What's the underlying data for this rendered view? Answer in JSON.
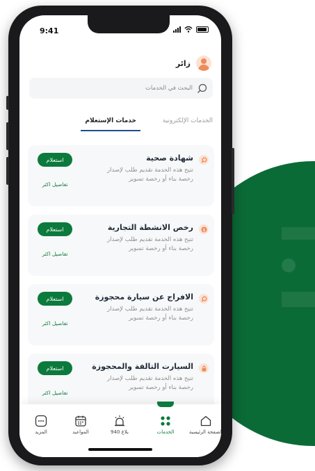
{
  "status_bar": {
    "time": "9:41"
  },
  "user": {
    "name": "زائر"
  },
  "search": {
    "placeholder": "البحث في الخدمات"
  },
  "tabs": [
    {
      "label": "الخدمات الإلكترونية",
      "active": false
    },
    {
      "label": "خدمات الإستعلام",
      "active": true
    }
  ],
  "cards": [
    {
      "title": "شهادة صحية",
      "desc": "تتيح هذه الخدمة تقديم طلب لإصدار رخصة بناء أو رخصة تسوير",
      "action": "استعلام",
      "more": "تفاصيل اكثر",
      "icon": "search-icon"
    },
    {
      "title": "رخص الانشطة التجارية",
      "desc": "تتيح هذه الخدمة تقديم طلب لإصدار رخصة بناء أو رخصة تسوير",
      "action": "استعلام",
      "more": "تفاصيل اكثر",
      "icon": "dollar-icon"
    },
    {
      "title": "الافراج عن سيارة محجوزة",
      "desc": "تتيح هذه الخدمة تقديم طلب لإصدار رخصة بناء أو رخصة تسوير",
      "action": "استعلام",
      "more": "تفاصيل اكثر",
      "icon": "search-icon"
    },
    {
      "title": "السيارت التالفة والمحجوزة",
      "desc": "تتيح هذه الخدمة تقديم طلب لإصدار رخصة بناء أو رخصة تسوير",
      "action": "استعلام",
      "more": "تفاصيل اكثر",
      "icon": "lock-icon"
    }
  ],
  "tabbar": [
    {
      "label": "المزيد",
      "icon": "more-icon"
    },
    {
      "label": "المواعيد",
      "icon": "calendar-icon"
    },
    {
      "label": "بلاغ 940",
      "icon": "alarm-icon"
    },
    {
      "label": "الخدمات",
      "icon": "grid-icon",
      "active": true
    },
    {
      "label": "الصفحة الرئيسية",
      "icon": "home-icon"
    }
  ],
  "colors": {
    "accent": "#0b7a3c",
    "brand_dark": "#0b6b36",
    "icon_orange": "#ee8a5b",
    "tab_underline": "#1f4d8a"
  }
}
